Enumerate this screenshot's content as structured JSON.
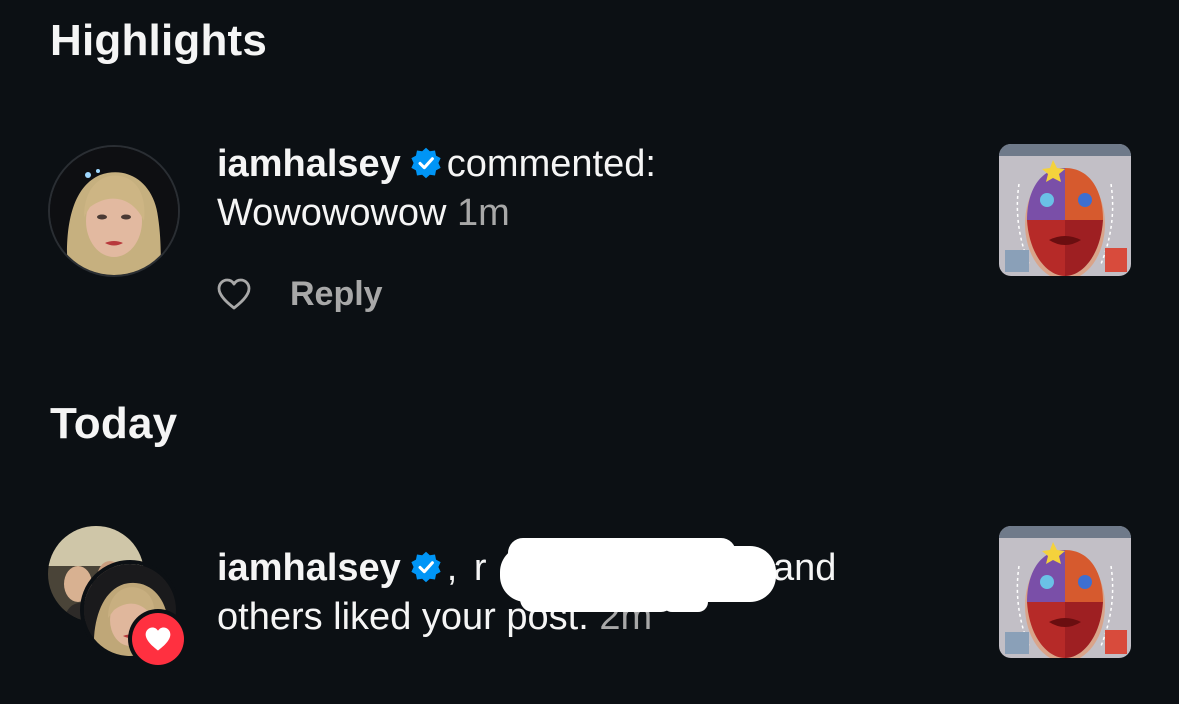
{
  "sections": {
    "highlights": "Highlights",
    "today": "Today"
  },
  "comment": {
    "username": "iamhalsey",
    "action": "commented:",
    "text": "Wowowowow",
    "time": "1m",
    "reply_label": "Reply"
  },
  "like": {
    "username": "iamhalsey",
    "separator": ",",
    "partial_name": "r",
    "conj": "and",
    "line2_prefix": "others liked you",
    "line2_hidden": "r post.",
    "time": "2m"
  },
  "colors": {
    "background": "#0c1014",
    "verified_blue": "#0095f6",
    "like_badge_red": "#ff3040",
    "secondary_text": "#a8a8a8"
  },
  "icons": {
    "verified": "verified-badge-icon",
    "heart_outline": "heart-outline-icon",
    "heart_badge": "heart-badge-icon"
  }
}
